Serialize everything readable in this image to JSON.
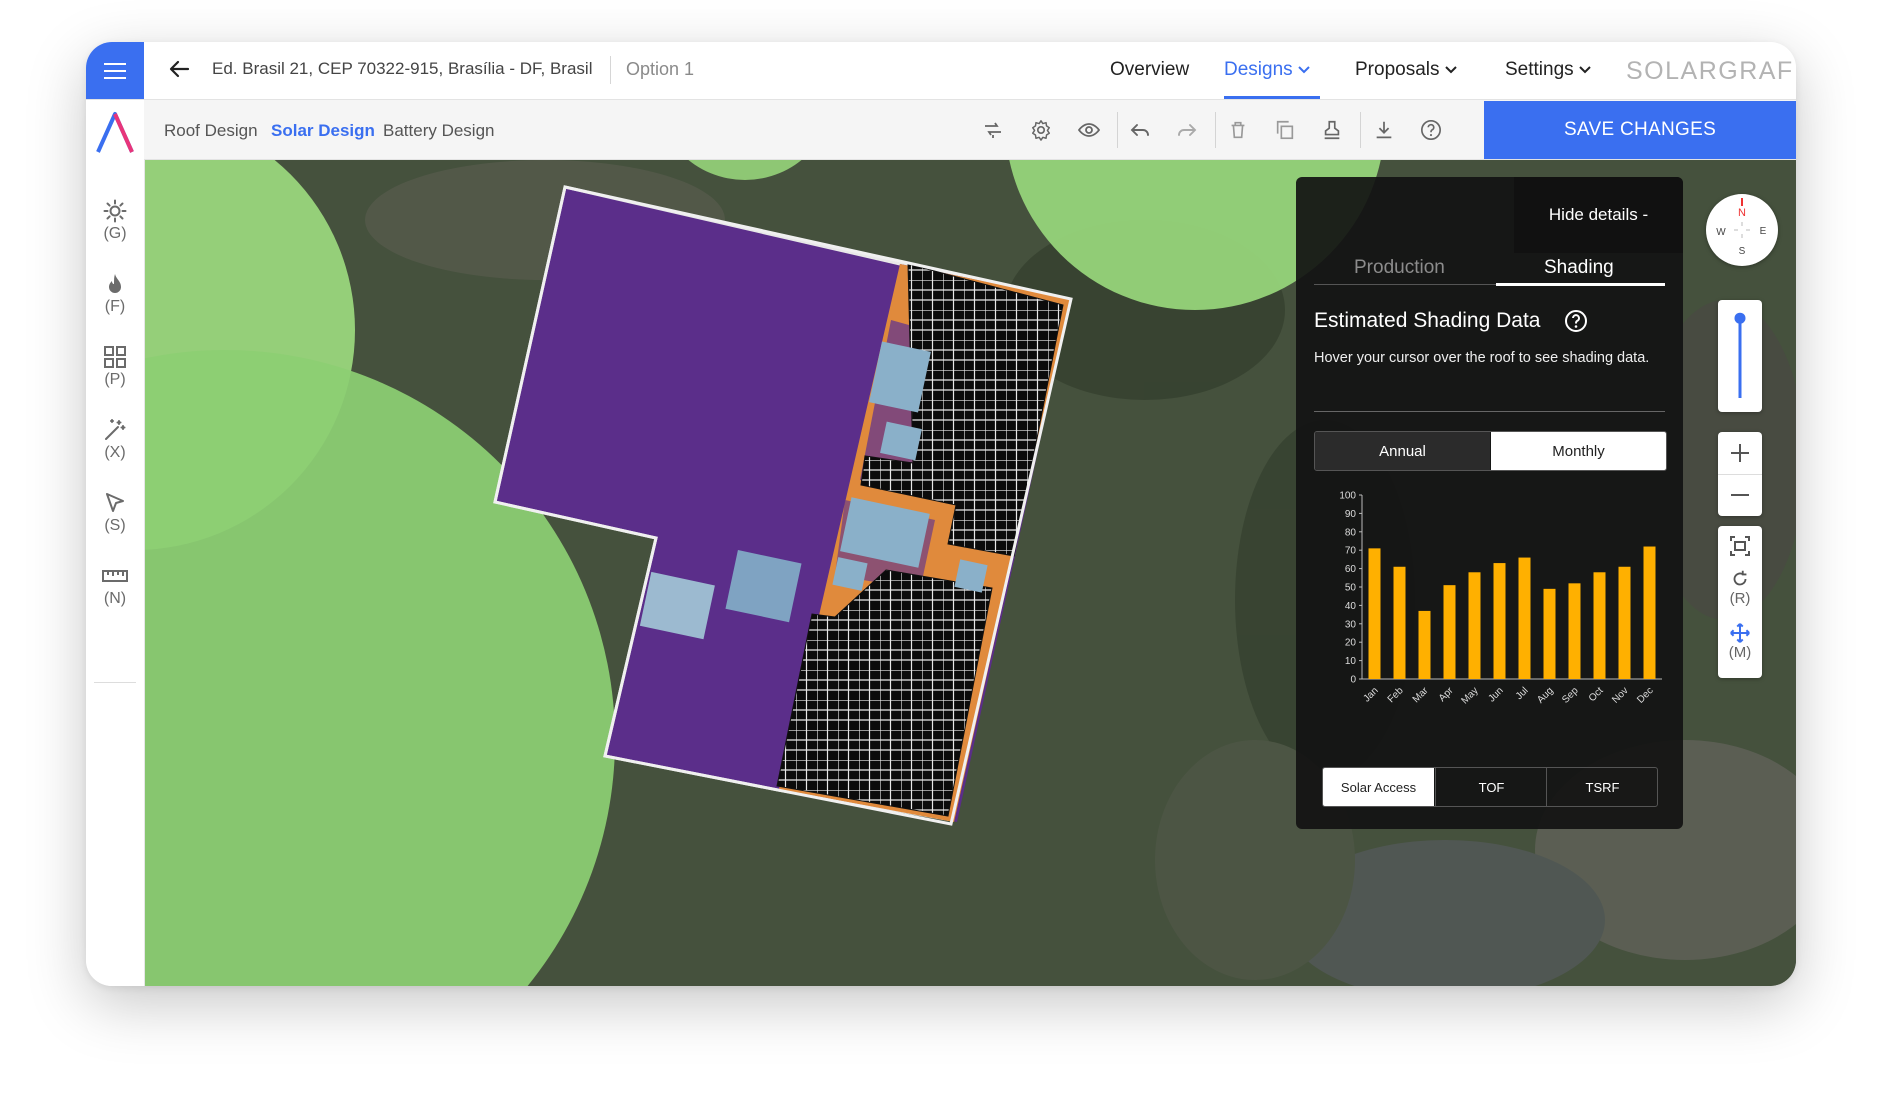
{
  "topbar": {
    "address": "Ed. Brasil 21, CEP 70322-915, Brasília - DF, Brasil",
    "option": "Option 1",
    "nav": {
      "overview": "Overview",
      "designs": "Designs",
      "proposals": "Proposals",
      "settings": "Settings"
    },
    "brand": "SOLARGRAF"
  },
  "subbar": {
    "tabs": {
      "roof": "Roof Design",
      "solar": "Solar Design",
      "battery": "Battery Design"
    },
    "save_label": "SAVE CHANGES"
  },
  "rail": [
    {
      "icon": "sun-icon",
      "key": "(G)"
    },
    {
      "icon": "fire-icon",
      "key": "(F)"
    },
    {
      "icon": "grid-icon",
      "key": "(P)"
    },
    {
      "icon": "magic-wand-icon",
      "key": "(X)"
    },
    {
      "icon": "cursor-icon",
      "key": "(S)"
    },
    {
      "icon": "ruler-icon",
      "key": "(N)"
    }
  ],
  "panel": {
    "hide_details": "Hide details -",
    "tabs": {
      "production": "Production",
      "shading": "Shading"
    },
    "title": "Estimated Shading Data",
    "hint": "Hover your cursor over the roof to see shading data.",
    "period_toggle": {
      "annual": "Annual",
      "monthly": "Monthly",
      "selected": "Monthly"
    },
    "metric_toggle": {
      "solar_access": "Solar Access",
      "tof": "TOF",
      "tsrf": "TSRF",
      "selected": "Solar Access"
    }
  },
  "chart_data": {
    "type": "bar",
    "categories": [
      "Jan",
      "Feb",
      "Mar",
      "Apr",
      "May",
      "Jun",
      "Jul",
      "Aug",
      "Sep",
      "Oct",
      "Nov",
      "Dec"
    ],
    "values": [
      71,
      61,
      37,
      51,
      58,
      63,
      66,
      49,
      52,
      58,
      61,
      72
    ],
    "yticks": [
      0,
      10,
      20,
      30,
      40,
      50,
      60,
      70,
      80,
      90,
      100
    ],
    "ylim": [
      0,
      100
    ],
    "bar_color": "#ffb000",
    "title": "",
    "xlabel": "",
    "ylabel": ""
  },
  "map_controls": {
    "compass": {
      "n": "N",
      "e": "E",
      "s": "S",
      "w": "W"
    },
    "zoom_level": 0.05,
    "rotate_key": "(R)",
    "move_key": "(M)"
  },
  "colors": {
    "accent": "#3a6ff0",
    "roof": "#5b2e8a",
    "panel_bg": "#121212",
    "tree": "#96d47a",
    "shade_orange": "#e08a3c"
  }
}
